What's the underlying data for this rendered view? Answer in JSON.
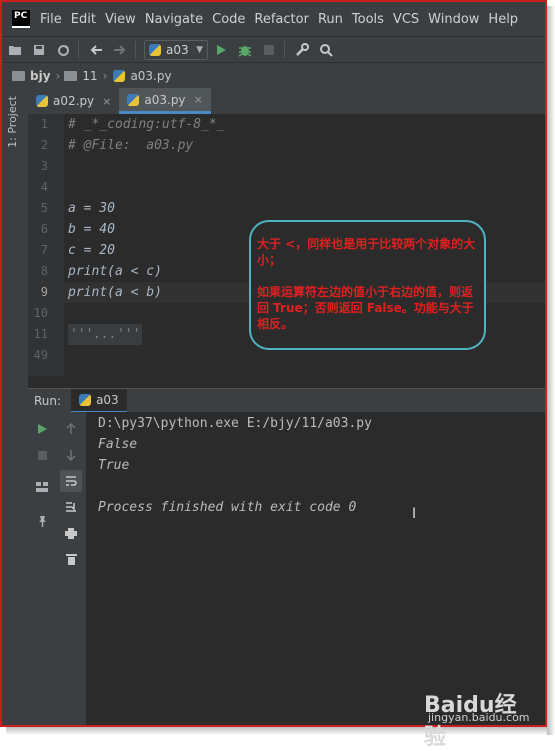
{
  "app": {
    "logo_text": "PC"
  },
  "menu": [
    "File",
    "Edit",
    "View",
    "Navigate",
    "Code",
    "Refactor",
    "Run",
    "Tools",
    "VCS",
    "Window",
    "Help"
  ],
  "toolbar": {
    "run_config": "a03"
  },
  "breadcrumb": [
    "bjy",
    "11",
    "a03.py"
  ],
  "side_panel": {
    "label": "1: Project"
  },
  "tabs": [
    {
      "label": "a02.py",
      "active": false
    },
    {
      "label": "a03.py",
      "active": true
    }
  ],
  "editor": {
    "lines": [
      {
        "n": "1",
        "text": "# _*_coding:utf-8_*_",
        "comment": true
      },
      {
        "n": "2",
        "text": "# @File:  a03.py",
        "comment": true
      },
      {
        "n": "3",
        "text": "",
        "comment": false
      },
      {
        "n": "4",
        "text": "",
        "comment": false
      },
      {
        "n": "5",
        "text": "a = 30",
        "comment": false
      },
      {
        "n": "6",
        "text": "b = 40",
        "comment": false
      },
      {
        "n": "7",
        "text": "c = 20",
        "comment": false
      },
      {
        "n": "8",
        "text": "print(a < c)",
        "comment": false
      },
      {
        "n": "9",
        "text": "print(a < b)",
        "comment": false
      },
      {
        "n": "10",
        "text": "",
        "comment": false
      },
      {
        "n": "11",
        "text": "'''...'''",
        "comment": true
      },
      {
        "n": "49",
        "text": "",
        "comment": false
      }
    ]
  },
  "annotation": {
    "para1": "大于 <，同样也是用于比较两个对象的大小；",
    "para2": "如果运算符左边的值小于右边的值，则返回 True；否则返回 False。功能与大于相反。"
  },
  "run_panel": {
    "label": "Run:",
    "tab": "a03"
  },
  "console": {
    "lines": [
      "D:\\py37\\python.exe E:/bjy/11/a03.py",
      "False",
      "True",
      "",
      "Process finished with exit code 0"
    ]
  },
  "watermark": {
    "brand": "Baidu经验",
    "url": "jingyan.baidu.com"
  }
}
